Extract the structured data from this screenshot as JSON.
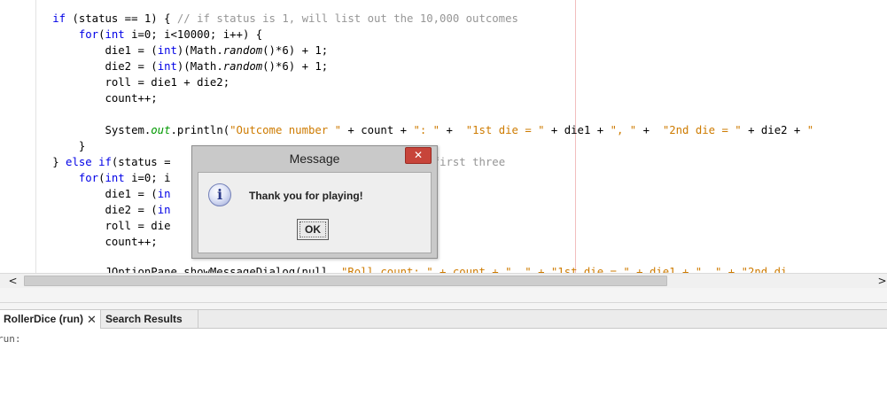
{
  "editor": {
    "lines": {
      "l1": {
        "a": "        ",
        "b": "if",
        "c": " (status == 1) { ",
        "d": "// if status is 1, will list out the 10,000 outcomes"
      },
      "l2": {
        "a": "            ",
        "b": "for",
        "c": "(",
        "d": "int",
        "e": " i=0; i<10000; i++) {"
      },
      "l3": {
        "a": "                die1 = (",
        "b": "int",
        "c": ")(Math.",
        "d": "random",
        "e": "()*6) + 1;"
      },
      "l4": {
        "a": "                die2 = (",
        "b": "int",
        "c": ")(Math.",
        "d": "random",
        "e": "()*6) + 1;"
      },
      "l5": {
        "a": "                roll = die1 + die2;"
      },
      "l6": {
        "a": "                count++;"
      },
      "l8": {
        "a": "                System.",
        "b": "out",
        "c": ".println(",
        "d": "\"Outcome number \"",
        "e": " + count + ",
        "f": "\": \"",
        "g": " +  ",
        "h": "\"1st die = \"",
        "i": " + die1 + ",
        "j": "\", \"",
        "k": " +  ",
        "l": "\"2nd die = \"",
        "m": " + die2 + ",
        "n": "\""
      },
      "l9": {
        "a": "            }"
      },
      "l10": {
        "a": "        } ",
        "b": "else if",
        "c": "(status = ",
        "d": "                               ",
        "e": "out the first three"
      },
      "l11": {
        "a": "            ",
        "b": "for",
        "c": "(",
        "d": "int",
        "e": " i=0; i"
      },
      "l12": {
        "a": "                die1 = (",
        "b": "in"
      },
      "l13": {
        "a": "                die2 = (",
        "b": "in"
      },
      "l14": {
        "a": "                roll = die"
      },
      "l15": {
        "a": "                count++;"
      },
      "l17": {
        "a": "                JOptionPane.showMessageDialog(null, ",
        "b": "\"Roll count: \" + count + \", \" + \"1st die = \" + die1 + \", \" + \"2nd di"
      }
    }
  },
  "scrollbar": {
    "left_arrow": "<",
    "right_arrow": ">"
  },
  "output_tabs": {
    "run_label": "RollerDice (run)",
    "run_close": "✕",
    "search_label": "Search Results"
  },
  "output": {
    "text": "run:"
  },
  "dialog": {
    "title": "Message",
    "close_glyph": "✕",
    "info_glyph": "i",
    "message": "Thank you for playing!",
    "ok_label": "OK"
  }
}
